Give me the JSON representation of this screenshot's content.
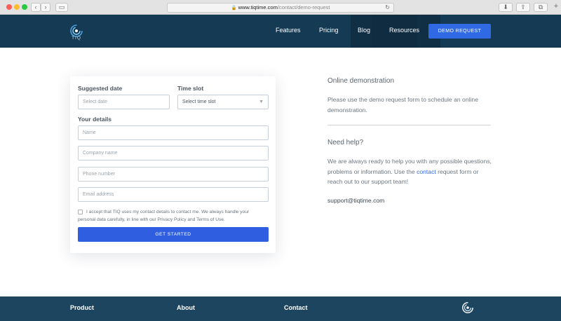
{
  "browser": {
    "url_host": "www.tiqtime.com",
    "url_path": "/contact/demo-request"
  },
  "header": {
    "logo_text": "TIQ",
    "nav": [
      "Features",
      "Pricing",
      "Blog",
      "Resources"
    ],
    "cta_label": "DEMO REQUEST"
  },
  "form": {
    "date_label": "Suggested date",
    "date_placeholder": "Select date",
    "slot_label": "Time slot",
    "slot_value": "Select time slot",
    "details_label": "Your details",
    "name_placeholder": "Name",
    "company_placeholder": "Company name",
    "phone_placeholder": "Phone number",
    "email_placeholder": "Email address",
    "consent_text": "I accept that TIQ uses my contact details to contact me. We always handle your personal data carefully, in line with our Privacy Policy and Terms of Use.",
    "submit_label": "GET STARTED"
  },
  "info": {
    "demo_title": "Online demonstration",
    "demo_text": "Please use the demo request form to schedule an online demonstration.",
    "help_title": "Need help?",
    "help_text_before": "We are always ready to help you with any possible questions, problems or information. Use the ",
    "help_link": "contact",
    "help_text_after": " request form or reach out to our support team!",
    "email": "support@tiqtime.com"
  },
  "footer": {
    "items": [
      "Product",
      "About",
      "Contact"
    ]
  },
  "colors": {
    "header_bg": "#153a54",
    "accent": "#2f6ae4",
    "footer_bg": "#1d4560"
  },
  "icons": [
    "back-icon",
    "forward-icon",
    "sidebar-icon",
    "lock-icon",
    "reload-icon",
    "download-icon",
    "share-icon",
    "tabs-icon",
    "new-tab-icon",
    "tiq-logo-icon",
    "chevron-down-icon"
  ]
}
